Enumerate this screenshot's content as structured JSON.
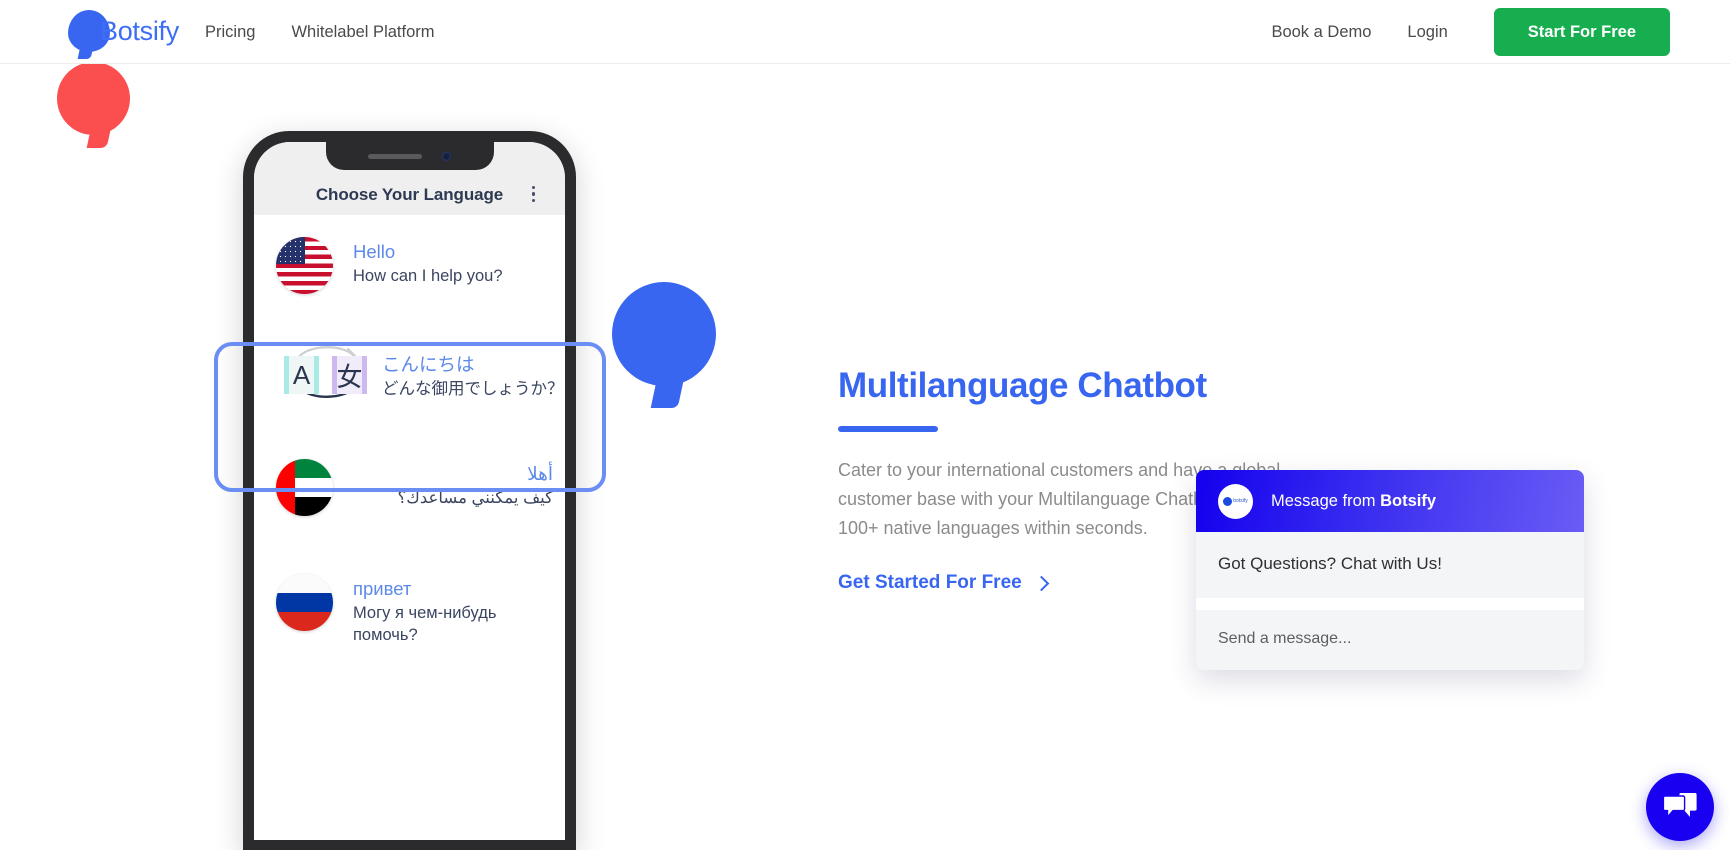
{
  "header": {
    "brand_name": "Botsify",
    "nav_left": [
      {
        "label": "Pricing"
      },
      {
        "label": "Whitelabel Platform"
      }
    ],
    "nav_right": [
      {
        "label": "Book a Demo"
      },
      {
        "label": "Login"
      }
    ],
    "cta_label": "Start For Free"
  },
  "phone": {
    "screen_title": "Choose Your Language",
    "languages": [
      {
        "code": "us",
        "greeting": "Hello",
        "subtitle": "How can I help you?",
        "rtl": false
      },
      {
        "code": "jp",
        "greeting": "こんにちは",
        "subtitle": "どんな御用でしょうか？",
        "rtl": false,
        "icon_latin": "A",
        "icon_cjk": "女"
      },
      {
        "code": "ae",
        "greeting": "أهلا",
        "subtitle": "كيف يمكنني مساعدك؟",
        "rtl": true
      },
      {
        "code": "ru",
        "greeting": "привет",
        "subtitle": "Могу я чем-нибудь помочь?",
        "rtl": false
      }
    ]
  },
  "main": {
    "headline": "Multilanguage Chatbot",
    "body": "Cater to your international customers and have a global customer base with your Multilanguage Chatbot. Translate into 100+ native languages within seconds.",
    "cta_label": "Get Started For Free"
  },
  "chat_widget": {
    "header_prefix": "Message from ",
    "header_brand": "Botsify",
    "avatar_label": "botsify",
    "prompt": "Got Questions? Chat with Us!",
    "input_placeholder": "Send a message..."
  },
  "colors": {
    "brand_blue": "#3866f0",
    "cta_green": "#16ae4f",
    "widget_blue": "#1a00f0",
    "accent_red": "#fb4f4f",
    "highlight_border": "#6b8ef5"
  }
}
